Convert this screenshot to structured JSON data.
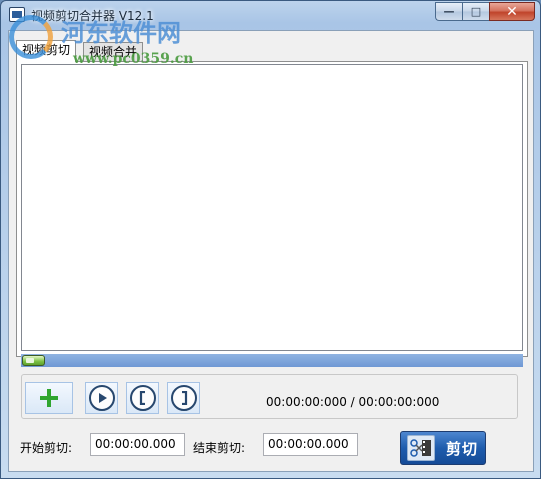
{
  "window": {
    "title": "视频剪切合并器 V12.1",
    "controls": {
      "minimize": "—",
      "maximize": "□",
      "close": "✕"
    }
  },
  "tabs": [
    {
      "label": "视频剪切",
      "active": true
    },
    {
      "label": "视频合并",
      "active": false
    }
  ],
  "progress": {
    "position_fraction": 0.0
  },
  "player": {
    "buttons": [
      {
        "name": "add",
        "icon": "plus-icon"
      },
      {
        "name": "play",
        "icon": "play-icon"
      },
      {
        "name": "mark-in",
        "icon": "bracket-left-icon",
        "glyph": "["
      },
      {
        "name": "mark-out",
        "icon": "bracket-right-icon",
        "glyph": "]"
      }
    ],
    "time_readout": "00:00:00:000 / 00:00:00:000"
  },
  "cut": {
    "start_label": "开始剪切:",
    "start_value": "00:00:00.000",
    "end_label": "结束剪切:",
    "end_value": "00:00:00.000",
    "button_label": "剪切"
  },
  "watermark": {
    "title": "河东软件网",
    "url": "www.pc0359.cn"
  },
  "colors": {
    "titlebar": "#a9c5e6",
    "progress_track": "#7aa2da",
    "handle": "#7bc043",
    "cut_button": "#1e5cad",
    "accent_green": "#2fa52f"
  }
}
